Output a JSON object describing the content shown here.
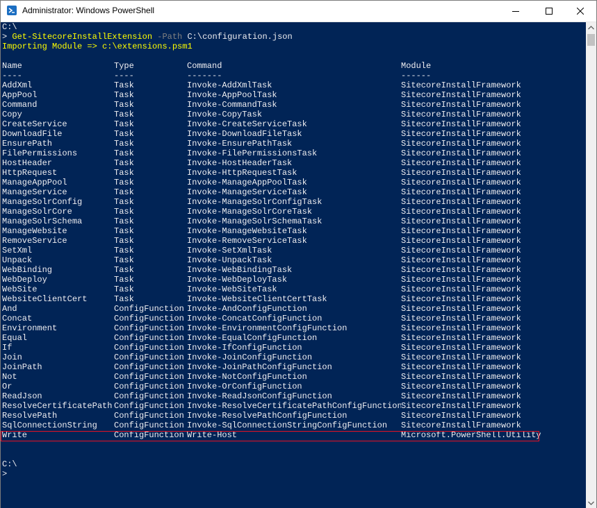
{
  "window": {
    "title": "Administrator: Windows PowerShell",
    "icon": "powershell-icon",
    "controls": [
      "minimize-icon",
      "maximize-icon",
      "close-icon"
    ]
  },
  "console": {
    "background": "#012456",
    "lines_before": [
      {
        "parts": [
          {
            "text": "C:\\",
            "style": "normal"
          }
        ]
      },
      {
        "parts": [
          {
            "text": "> ",
            "style": "normal"
          },
          {
            "text": "Get-SitecoreInstallExtension",
            "style": "yellow"
          },
          {
            "text": " -Path",
            "style": "param"
          },
          {
            "text": " C:\\configuration.json",
            "style": "normal"
          }
        ]
      },
      {
        "parts": [
          {
            "text": "Importing Module => c:\\extensions.psm1",
            "style": "yellow"
          }
        ]
      },
      {
        "parts": [
          {
            "text": "",
            "style": "normal"
          }
        ]
      }
    ],
    "table": {
      "headers": [
        "Name",
        "Type",
        "Command",
        "Module"
      ],
      "underlines": [
        "----",
        "----",
        "-------",
        "------"
      ],
      "rows": [
        [
          "AddXml",
          "Task",
          "Invoke-AddXmlTask",
          "SitecoreInstallFramework"
        ],
        [
          "AppPool",
          "Task",
          "Invoke-AppPoolTask",
          "SitecoreInstallFramework"
        ],
        [
          "Command",
          "Task",
          "Invoke-CommandTask",
          "SitecoreInstallFramework"
        ],
        [
          "Copy",
          "Task",
          "Invoke-CopyTask",
          "SitecoreInstallFramework"
        ],
        [
          "CreateService",
          "Task",
          "Invoke-CreateServiceTask",
          "SitecoreInstallFramework"
        ],
        [
          "DownloadFile",
          "Task",
          "Invoke-DownloadFileTask",
          "SitecoreInstallFramework"
        ],
        [
          "EnsurePath",
          "Task",
          "Invoke-EnsurePathTask",
          "SitecoreInstallFramework"
        ],
        [
          "FilePermissions",
          "Task",
          "Invoke-FilePermissionsTask",
          "SitecoreInstallFramework"
        ],
        [
          "HostHeader",
          "Task",
          "Invoke-HostHeaderTask",
          "SitecoreInstallFramework"
        ],
        [
          "HttpRequest",
          "Task",
          "Invoke-HttpRequestTask",
          "SitecoreInstallFramework"
        ],
        [
          "ManageAppPool",
          "Task",
          "Invoke-ManageAppPoolTask",
          "SitecoreInstallFramework"
        ],
        [
          "ManageService",
          "Task",
          "Invoke-ManageServiceTask",
          "SitecoreInstallFramework"
        ],
        [
          "ManageSolrConfig",
          "Task",
          "Invoke-ManageSolrConfigTask",
          "SitecoreInstallFramework"
        ],
        [
          "ManageSolrCore",
          "Task",
          "Invoke-ManageSolrCoreTask",
          "SitecoreInstallFramework"
        ],
        [
          "ManageSolrSchema",
          "Task",
          "Invoke-ManageSolrSchemaTask",
          "SitecoreInstallFramework"
        ],
        [
          "ManageWebsite",
          "Task",
          "Invoke-ManageWebsiteTask",
          "SitecoreInstallFramework"
        ],
        [
          "RemoveService",
          "Task",
          "Invoke-RemoveServiceTask",
          "SitecoreInstallFramework"
        ],
        [
          "SetXml",
          "Task",
          "Invoke-SetXmlTask",
          "SitecoreInstallFramework"
        ],
        [
          "Unpack",
          "Task",
          "Invoke-UnpackTask",
          "SitecoreInstallFramework"
        ],
        [
          "WebBinding",
          "Task",
          "Invoke-WebBindingTask",
          "SitecoreInstallFramework"
        ],
        [
          "WebDeploy",
          "Task",
          "Invoke-WebDeployTask",
          "SitecoreInstallFramework"
        ],
        [
          "WebSite",
          "Task",
          "Invoke-WebSiteTask",
          "SitecoreInstallFramework"
        ],
        [
          "WebsiteClientCert",
          "Task",
          "Invoke-WebsiteClientCertTask",
          "SitecoreInstallFramework"
        ],
        [
          "And",
          "ConfigFunction",
          "Invoke-AndConfigFunction",
          "SitecoreInstallFramework"
        ],
        [
          "Concat",
          "ConfigFunction",
          "Invoke-ConcatConfigFunction",
          "SitecoreInstallFramework"
        ],
        [
          "Environment",
          "ConfigFunction",
          "Invoke-EnvironmentConfigFunction",
          "SitecoreInstallFramework"
        ],
        [
          "Equal",
          "ConfigFunction",
          "Invoke-EqualConfigFunction",
          "SitecoreInstallFramework"
        ],
        [
          "If",
          "ConfigFunction",
          "Invoke-IfConfigFunction",
          "SitecoreInstallFramework"
        ],
        [
          "Join",
          "ConfigFunction",
          "Invoke-JoinConfigFunction",
          "SitecoreInstallFramework"
        ],
        [
          "JoinPath",
          "ConfigFunction",
          "Invoke-JoinPathConfigFunction",
          "SitecoreInstallFramework"
        ],
        [
          "Not",
          "ConfigFunction",
          "Invoke-NotConfigFunction",
          "SitecoreInstallFramework"
        ],
        [
          "Or",
          "ConfigFunction",
          "Invoke-OrConfigFunction",
          "SitecoreInstallFramework"
        ],
        [
          "ReadJson",
          "ConfigFunction",
          "Invoke-ReadJsonConfigFunction",
          "SitecoreInstallFramework"
        ],
        [
          "ResolveCertificatePath",
          "ConfigFunction",
          "Invoke-ResolveCertificatePathConfigFunction",
          "SitecoreInstallFramework"
        ],
        [
          "ResolvePath",
          "ConfigFunction",
          "Invoke-ResolvePathConfigFunction",
          "SitecoreInstallFramework"
        ],
        [
          "SqlConnectionString",
          "ConfigFunction",
          "Invoke-SqlConnectionStringConfigFunction",
          "SitecoreInstallFramework"
        ],
        [
          "Write",
          "ConfigFunction",
          "Write-Host",
          "Microsoft.PowerShell.Utility"
        ]
      ],
      "highlighted_row": "Write",
      "highlight_color": "#e81123"
    },
    "lines_after": [
      {
        "parts": [
          {
            "text": "",
            "style": "normal"
          }
        ]
      },
      {
        "parts": [
          {
            "text": "",
            "style": "normal"
          }
        ]
      },
      {
        "parts": [
          {
            "text": "C:\\",
            "style": "normal"
          }
        ]
      },
      {
        "parts": [
          {
            "text": ">",
            "style": "normal"
          }
        ]
      }
    ]
  },
  "scrollbar": {
    "up_icon": "scroll-up-arrow-icon",
    "down_icon": "scroll-down-arrow-icon"
  }
}
